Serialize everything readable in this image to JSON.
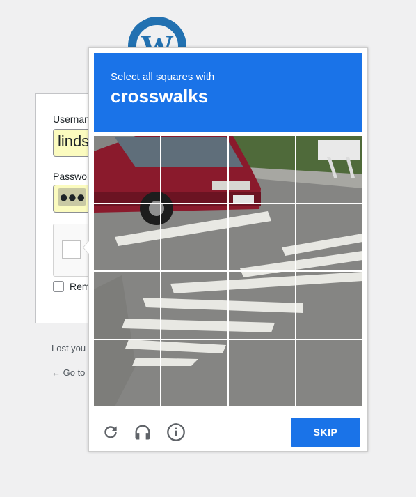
{
  "background_form": {
    "username_label": "Usernam",
    "username_value": "linds",
    "password_label": "Passwor",
    "password_dots": "●●●",
    "remember_label": "Rem",
    "lost_password_text": "Lost you",
    "back_link_text": "← Go to"
  },
  "challenge": {
    "instruction_small": "Select all squares with",
    "instruction_target": "crosswalks",
    "grid": {
      "rows": 4,
      "cols": 4
    },
    "skip_label": "SKIP",
    "icons": [
      "reload-icon",
      "headphones-icon",
      "info-icon"
    ]
  },
  "colors": {
    "accent": "#1a73e8",
    "wordpress_blue": "#2271b1",
    "page_bg": "#f0f0f1"
  }
}
